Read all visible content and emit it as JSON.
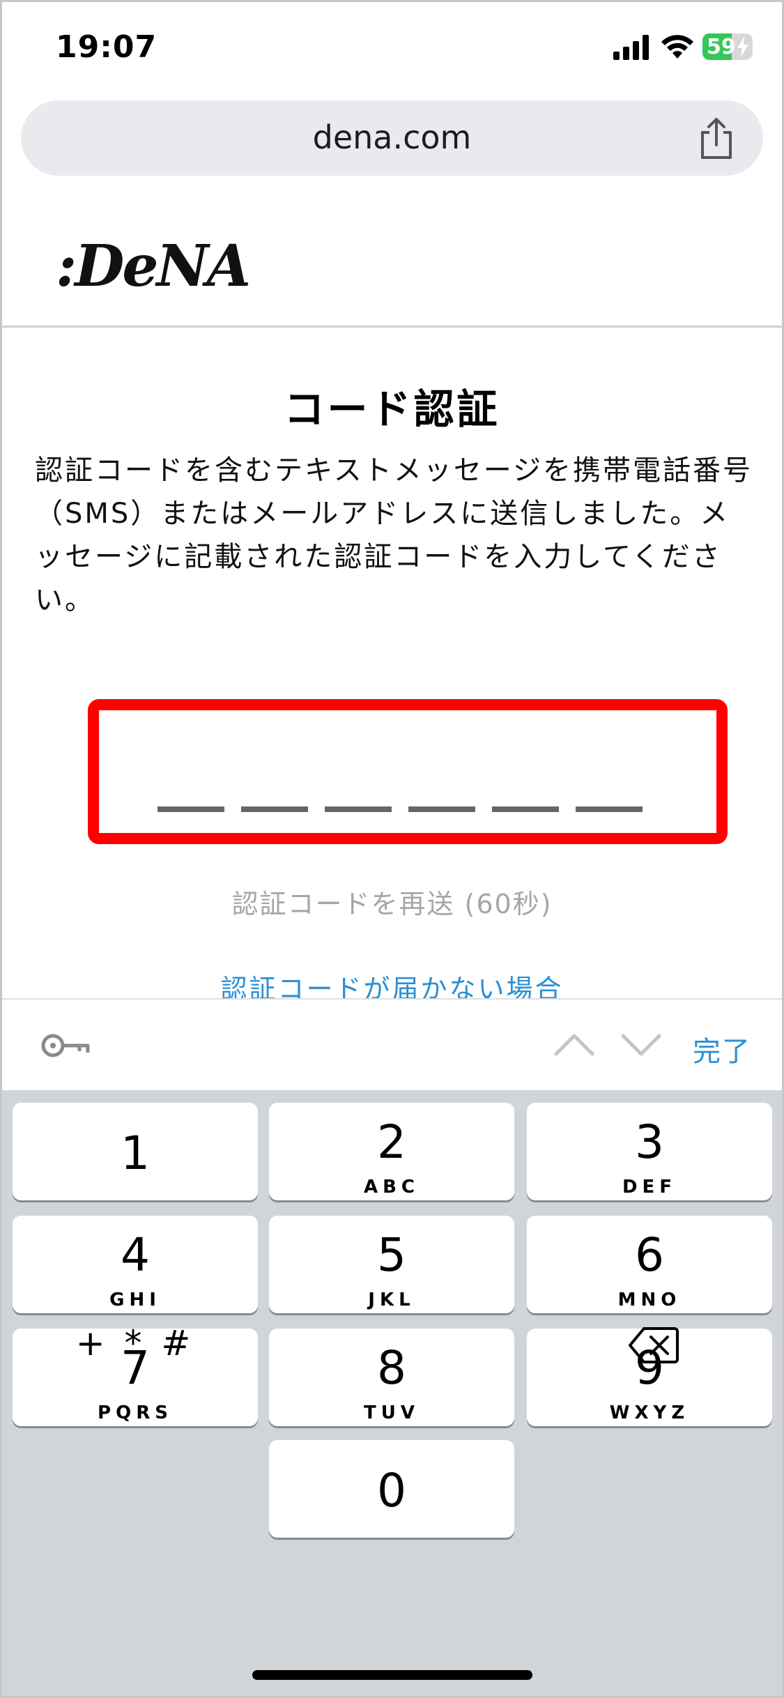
{
  "status_bar": {
    "time": "19:07",
    "battery": "59",
    "battery_level": 0.59,
    "battery_color": "#34c759"
  },
  "browser": {
    "url": "dena.com",
    "share_icon": "share-icon"
  },
  "header": {
    "logo": ":DeNA"
  },
  "main": {
    "title": "コード認証",
    "description": "認証コードを含むテキストメッセージを携帯電話番号（SMS）またはメールアドレスに送信しました。メッセージに記載された認証コードを入力してください。",
    "code_length": 6,
    "code_box_border": "#ff0000",
    "resend_label": "認証コードを再送 (60秒)",
    "help_link": "認証コードが届かない場合",
    "link_color": "#2a8fd6"
  },
  "accessory": {
    "key_icon": "key-icon",
    "up_icon": "chevron-up-icon",
    "down_icon": "chevron-down-icon",
    "done_label": "完了"
  },
  "keyboard": {
    "keys": [
      {
        "digit": "1",
        "letters": ""
      },
      {
        "digit": "2",
        "letters": "ABC"
      },
      {
        "digit": "3",
        "letters": "DEF"
      },
      {
        "digit": "4",
        "letters": "GHI"
      },
      {
        "digit": "5",
        "letters": "JKL"
      },
      {
        "digit": "6",
        "letters": "MNO"
      },
      {
        "digit": "7",
        "letters": "PQRS"
      },
      {
        "digit": "8",
        "letters": "TUV"
      },
      {
        "digit": "9",
        "letters": "WXYZ"
      },
      {
        "digit": "0",
        "letters": ""
      }
    ],
    "symbols_label": "+ * #",
    "delete_icon": "delete-icon"
  }
}
